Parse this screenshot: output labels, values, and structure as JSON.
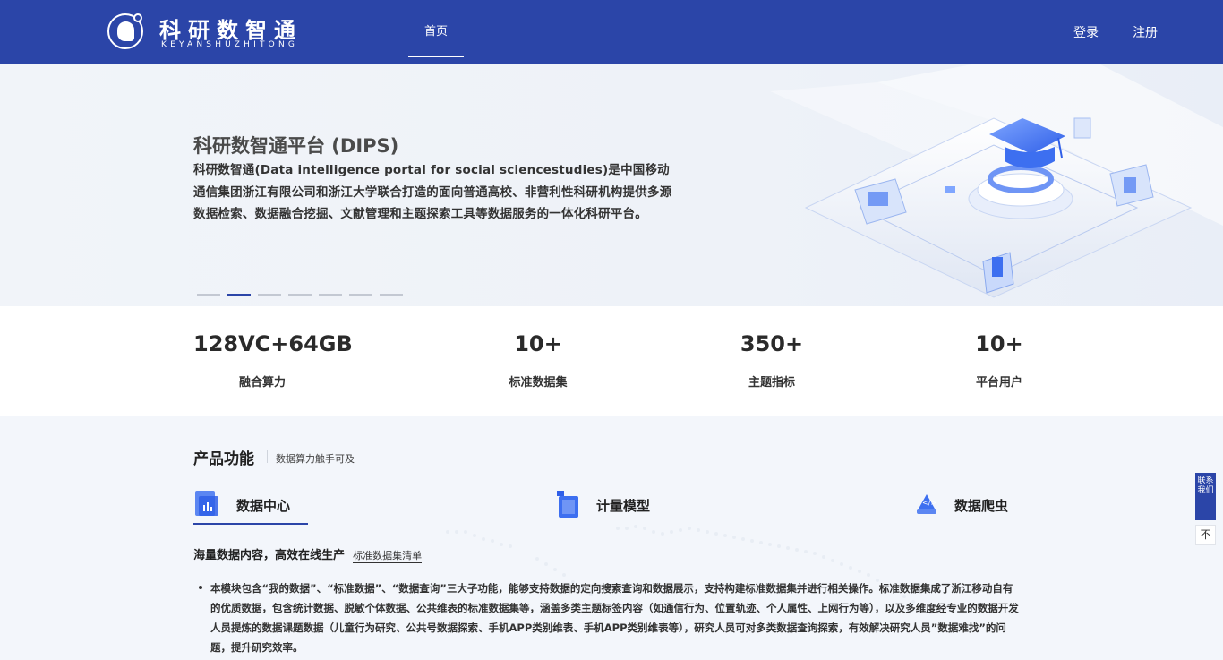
{
  "header": {
    "logo_cn": "科研数智通",
    "logo_en": "KEYANSHUZHITONG",
    "nav_home": "首页",
    "login": "登录",
    "register": "注册"
  },
  "hero": {
    "title": "科研数智通平台 (DIPS)",
    "description": "科研数智通(Data intelligence portal for social sciencestudies)是中国移动通信集团浙江有限公司和浙江大学联合打造的面向普通高校、非营利性科研机构提供多源数据检索、数据融合挖掘、文献管理和主题探索工具等数据服务的一体化科研平台。",
    "carousel_count": 7,
    "carousel_active": 2
  },
  "stats": [
    {
      "value": "128VC+64GB",
      "label": "融合算力"
    },
    {
      "value": "10+",
      "label": "标准数据集"
    },
    {
      "value": "350+",
      "label": "主题指标"
    },
    {
      "value": "10+",
      "label": "平台用户"
    }
  ],
  "product": {
    "title": "产品功能",
    "subtitle": "数据算力触手可及",
    "tabs": [
      {
        "label": "数据中心",
        "icon": "data-center-icon",
        "active": true
      },
      {
        "label": "计量模型",
        "icon": "model-icon",
        "active": false
      },
      {
        "label": "数据爬虫",
        "icon": "crawler-icon",
        "active": false
      }
    ],
    "sub_heading": "海量数据内容，高效在线生产",
    "sub_link": "标准数据集清单",
    "bullet": "本模块包含“我的数据”、“标准数据”、“数据查询”三大子功能，能够支持数据的定向搜索查询和数据展示，支持构建标准数据集并进行相关操作。标准数据集成了浙江移动自有的优质数据，包含统计数据、脱敏个体数据、公共维表的标准数据集等，涵盖多类主题标签内容（如通信行为、位置轨迹、个人属性、上网行为等），以及多维度经专业的数据开发人员提炼的数据课题数据（儿童行为研究、公共号数据探索、手机APP类别维表、手机APP类别维表等），研究人员可对多类数据查询探索，有效解决研究人员”数据难找”的问题，提升研究效率。"
  },
  "side": {
    "contact": "联系我们",
    "back_top": "不"
  },
  "colors": {
    "brand": "#2b45a8"
  }
}
